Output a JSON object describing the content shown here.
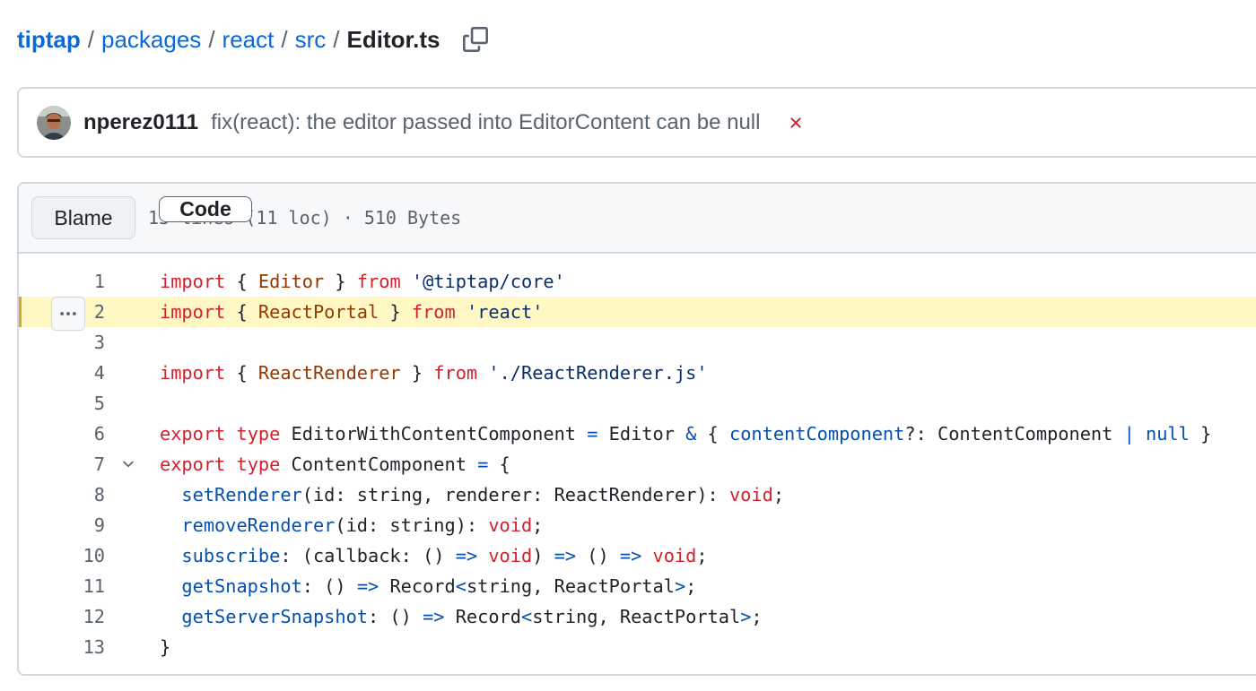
{
  "breadcrumb": {
    "repo": "tiptap",
    "parts": [
      "packages",
      "react",
      "src"
    ],
    "separator": "/",
    "current": "Editor.ts",
    "copy_icon": "copy-icon"
  },
  "commit": {
    "author": "nperez0111",
    "message": "fix(react): the editor passed into EditorContent can be null",
    "status_icon": "x-icon",
    "status_color": "#cf222e"
  },
  "file": {
    "tabs": {
      "code": "Code",
      "blame": "Blame"
    },
    "info": "13 lines (11 loc) · 510 Bytes",
    "highlighted_line": 2,
    "line_menu_icon": "kebab-horizontal-icon",
    "fold_icon": "chevron-down-icon",
    "lines": [
      {
        "n": "1",
        "tokens": [
          [
            "k",
            "import"
          ],
          [
            "p",
            " { "
          ],
          [
            "t",
            "Editor"
          ],
          [
            "p",
            " } "
          ],
          [
            "k",
            "from"
          ],
          [
            "p",
            " "
          ],
          [
            "s",
            "'@tiptap/core'"
          ]
        ]
      },
      {
        "n": "2",
        "tokens": [
          [
            "k",
            "import"
          ],
          [
            "p",
            " { "
          ],
          [
            "t",
            "ReactPortal"
          ],
          [
            "p",
            " } "
          ],
          [
            "k",
            "from"
          ],
          [
            "p",
            " "
          ],
          [
            "s",
            "'react'"
          ]
        ]
      },
      {
        "n": "3",
        "tokens": []
      },
      {
        "n": "4",
        "tokens": [
          [
            "k",
            "import"
          ],
          [
            "p",
            " { "
          ],
          [
            "t",
            "ReactRenderer"
          ],
          [
            "p",
            " } "
          ],
          [
            "k",
            "from"
          ],
          [
            "p",
            " "
          ],
          [
            "s",
            "'./ReactRenderer.js'"
          ]
        ]
      },
      {
        "n": "5",
        "tokens": []
      },
      {
        "n": "6",
        "tokens": [
          [
            "k",
            "export"
          ],
          [
            "p",
            " "
          ],
          [
            "k",
            "type"
          ],
          [
            "p",
            " EditorWithContentComponent "
          ],
          [
            "f",
            "="
          ],
          [
            "p",
            " Editor "
          ],
          [
            "f",
            "&"
          ],
          [
            "p",
            " { "
          ],
          [
            "f",
            "contentComponent"
          ],
          [
            "p",
            "?: ContentComponent "
          ],
          [
            "f",
            "|"
          ],
          [
            "p",
            " "
          ],
          [
            "f",
            "null"
          ],
          [
            "p",
            " }"
          ]
        ]
      },
      {
        "n": "7",
        "tokens": [
          [
            "k",
            "export"
          ],
          [
            "p",
            " "
          ],
          [
            "k",
            "type"
          ],
          [
            "p",
            " ContentComponent "
          ],
          [
            "f",
            "="
          ],
          [
            "p",
            " {"
          ]
        ]
      },
      {
        "n": "8",
        "tokens": [
          [
            "p",
            "  "
          ],
          [
            "f",
            "setRenderer"
          ],
          [
            "p",
            "(id: string, renderer: ReactRenderer): "
          ],
          [
            "k",
            "void"
          ],
          [
            "p",
            ";"
          ]
        ]
      },
      {
        "n": "9",
        "tokens": [
          [
            "p",
            "  "
          ],
          [
            "f",
            "removeRenderer"
          ],
          [
            "p",
            "(id: string): "
          ],
          [
            "k",
            "void"
          ],
          [
            "p",
            ";"
          ]
        ]
      },
      {
        "n": "10",
        "tokens": [
          [
            "p",
            "  "
          ],
          [
            "f",
            "subscribe"
          ],
          [
            "p",
            ": (callback: () "
          ],
          [
            "f",
            "=>"
          ],
          [
            "p",
            " "
          ],
          [
            "k",
            "void"
          ],
          [
            "p",
            ") "
          ],
          [
            "f",
            "=>"
          ],
          [
            "p",
            " () "
          ],
          [
            "f",
            "=>"
          ],
          [
            "p",
            " "
          ],
          [
            "k",
            "void"
          ],
          [
            "p",
            ";"
          ]
        ]
      },
      {
        "n": "11",
        "tokens": [
          [
            "p",
            "  "
          ],
          [
            "f",
            "getSnapshot"
          ],
          [
            "p",
            ": () "
          ],
          [
            "f",
            "=>"
          ],
          [
            "p",
            " Record"
          ],
          [
            "f",
            "<"
          ],
          [
            "p",
            "string, ReactPortal"
          ],
          [
            "f",
            ">"
          ],
          [
            "p",
            ";"
          ]
        ]
      },
      {
        "n": "12",
        "tokens": [
          [
            "p",
            "  "
          ],
          [
            "f",
            "getServerSnapshot"
          ],
          [
            "p",
            ": () "
          ],
          [
            "f",
            "=>"
          ],
          [
            "p",
            " Record"
          ],
          [
            "f",
            "<"
          ],
          [
            "p",
            "string, ReactPortal"
          ],
          [
            "f",
            ">"
          ],
          [
            "p",
            ";"
          ]
        ]
      },
      {
        "n": "13",
        "tokens": [
          [
            "p",
            "}"
          ]
        ]
      }
    ]
  }
}
